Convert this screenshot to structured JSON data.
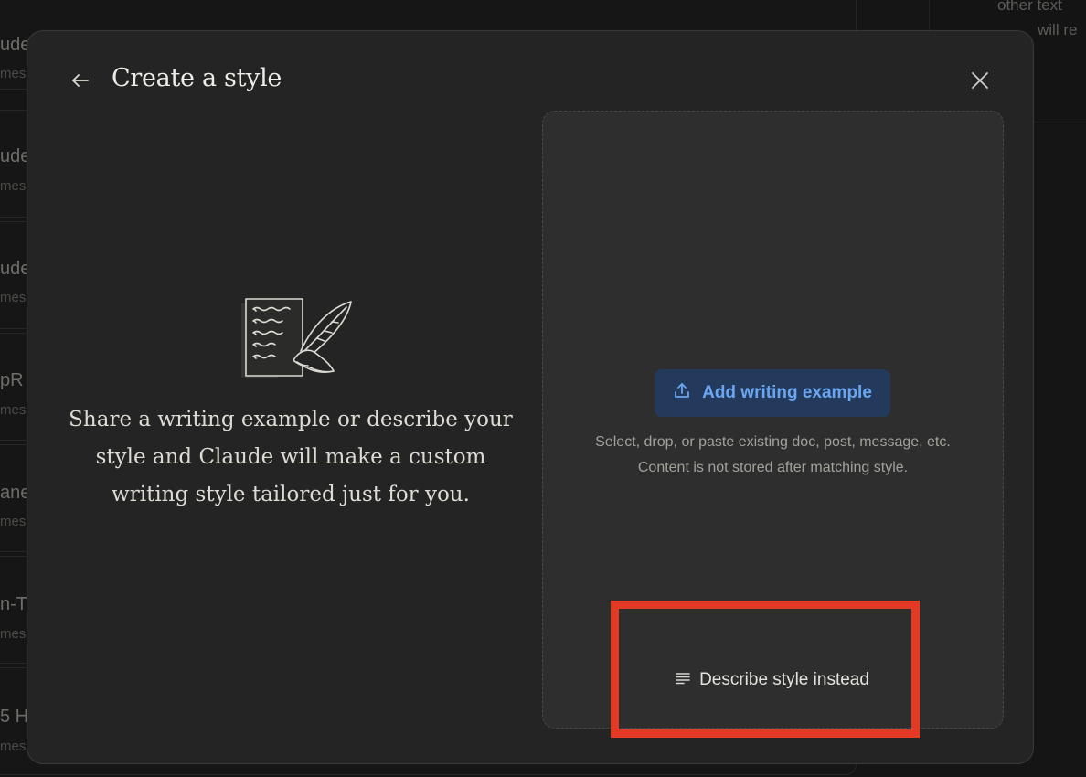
{
  "background": {
    "items": [
      {
        "title": "ude",
        "subtitle": "mes"
      },
      {
        "title": "ude",
        "subtitle": "mes"
      },
      {
        "title": "ude",
        "subtitle": "mes"
      },
      {
        "title": "pR",
        "subtitle": "mes"
      },
      {
        "title": "ane",
        "subtitle": "mes"
      },
      {
        "title": "n-T",
        "subtitle": "mes"
      },
      {
        "title": "5 H",
        "subtitle": "mes"
      }
    ],
    "right_panel": {
      "line1": "other text",
      "line2": "will re"
    }
  },
  "modal": {
    "title": "Create a style",
    "intro_text": "Share a writing example or describe your style and Claude will make a custom writing style tailored just for you.",
    "add_button_label": "Add writing example",
    "hint_line1": "Select, drop, or paste existing doc, post, message, etc.",
    "hint_line2": "Content is not stored after matching style.",
    "describe_button_label": "Describe style instead"
  },
  "colors": {
    "accent_text": "#6aa6f0",
    "accent_bg": "#243a5c",
    "highlight": "#e33a26"
  },
  "icons": {
    "back": "arrow-left-icon",
    "close": "close-icon",
    "upload": "upload-icon",
    "describe": "text-lines-icon",
    "illustration": "document-quill-illustration"
  }
}
